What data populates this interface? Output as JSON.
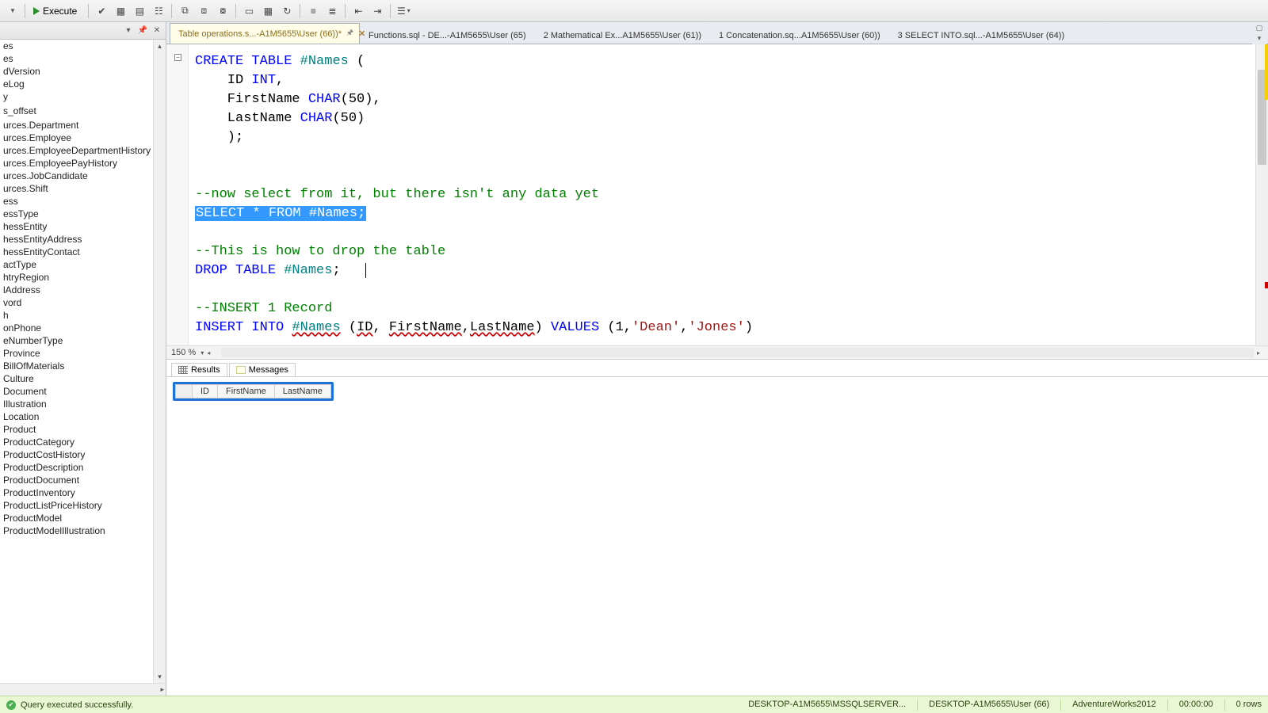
{
  "toolbar": {
    "execute_label": "Execute"
  },
  "tabs": [
    {
      "label": "Table operations.s...-A1M5655\\User (66))*",
      "active": true,
      "pinned": true
    },
    {
      "label": "Functions.sql - DE...-A1M5655\\User (65)",
      "active": false
    },
    {
      "label": "2 Mathematical Ex...A1M5655\\User (61))",
      "active": false
    },
    {
      "label": "1 Concatenation.sq...A1M5655\\User (60))",
      "active": false
    },
    {
      "label": "3 SELECT INTO.sql...-A1M5655\\User (64))",
      "active": false
    }
  ],
  "sidebar_items": [
    "es",
    "es",
    "dVersion",
    "eLog",
    "y",
    "",
    "s_offset",
    "",
    "urces.Department",
    "urces.Employee",
    "urces.EmployeeDepartmentHistory",
    "urces.EmployeePayHistory",
    "urces.JobCandidate",
    "urces.Shift",
    "ess",
    "essType",
    "hessEntity",
    "hessEntityAddress",
    "hessEntityContact",
    "actType",
    "htryRegion",
    "lAddress",
    "vord",
    "h",
    "onPhone",
    "eNumberType",
    "Province",
    "BillOfMaterials",
    "Culture",
    "Document",
    "Illustration",
    "Location",
    "Product",
    "ProductCategory",
    "ProductCostHistory",
    "ProductDescription",
    "ProductDocument",
    "ProductInventory",
    "ProductListPriceHistory",
    "ProductModel",
    "ProductModelIllustration"
  ],
  "code": {
    "l1a": "CREATE",
    "l1b": "TABLE",
    "l1c": "#Names",
    "l1d": " (",
    "l2a": "    ID ",
    "l2b": "INT",
    "l2c": ",",
    "l3a": "    FirstName ",
    "l3b": "CHAR",
    "l3c": "(",
    "l3d": "50",
    "l3e": "),",
    "l4a": "    LastName ",
    "l4b": "CHAR",
    "l4c": "(",
    "l4d": "50",
    "l4e": ")",
    "l5": "    );",
    "l6": "",
    "c1": "--now select from it, but there isn't any data yet",
    "s1a": "SELECT",
    "s1b": " * ",
    "s1c": "FROM",
    "s1d": " ",
    "s1e": "#Names",
    "s1f": ";",
    "c2": "--This is how to drop the table",
    "d1a": "DROP",
    "d1b": "TABLE",
    "d1c": "#Names",
    "d1d": ";",
    "c3": "--INSERT 1 Record",
    "i1a": "INSERT",
    "i1b": "INTO",
    "i1c": "#Names",
    "i1d": "ID",
    "i1e": "FirstName",
    "i1f": "LastName",
    "i1g": "VALUES",
    "i1h": "1",
    "i1i": "'Dean'",
    "i1j": "'Jones'"
  },
  "zoom": "150 %",
  "results": {
    "tabs": [
      "Results",
      "Messages"
    ],
    "columns": [
      "ID",
      "FirstName",
      "LastName"
    ]
  },
  "status": {
    "message": "Query executed successfully.",
    "server": "DESKTOP-A1M5655\\MSSQLSERVER...",
    "user": "DESKTOP-A1M5655\\User (66)",
    "db": "AdventureWorks2012",
    "time": "00:00:00",
    "rows": "0 rows"
  }
}
